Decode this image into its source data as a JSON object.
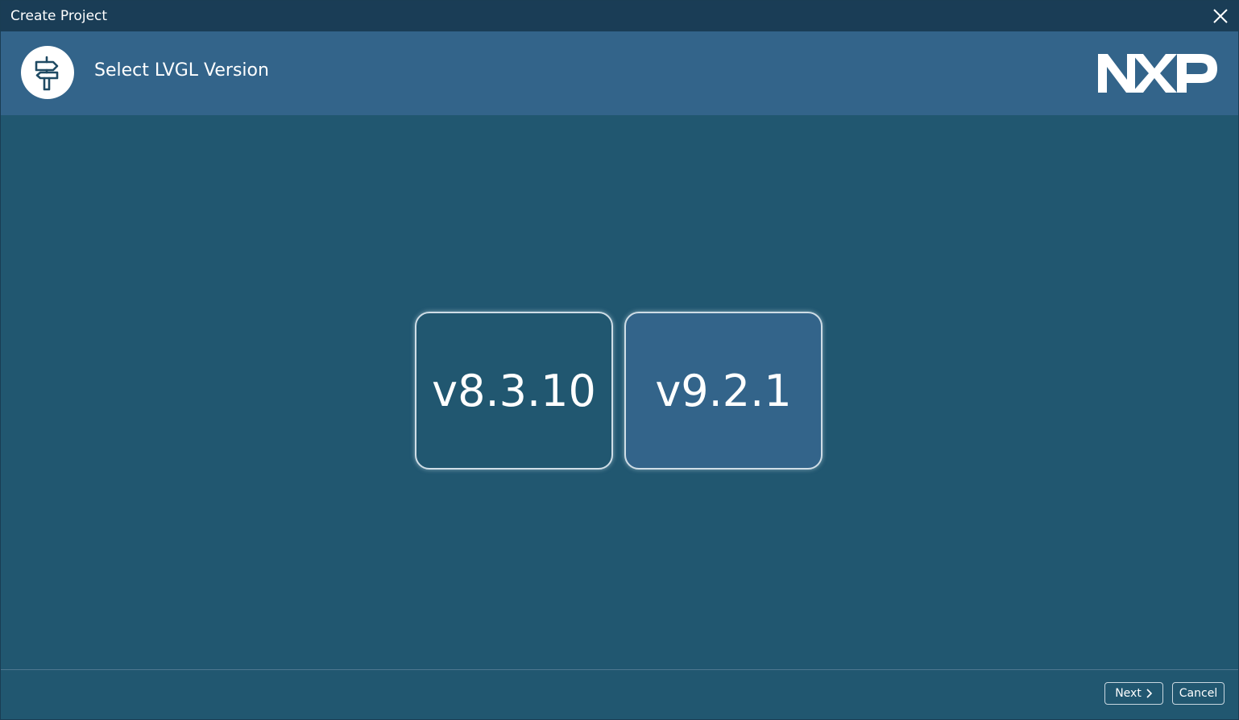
{
  "window": {
    "title": "Create Project"
  },
  "header": {
    "title": "Select LVGL Version",
    "logo_text": "NXP"
  },
  "versions": [
    {
      "label": "v8.3.10",
      "selected": false
    },
    {
      "label": "v9.2.1",
      "selected": true
    }
  ],
  "footer": {
    "next_label": "Next",
    "cancel_label": "Cancel"
  },
  "colors": {
    "titlebar": "#1a3d56",
    "header": "#33648a",
    "content": "#215770",
    "selected_card": "#33648a"
  },
  "icons": {
    "header": "signpost-icon",
    "close": "close-icon",
    "next": "chevron-right-icon"
  }
}
